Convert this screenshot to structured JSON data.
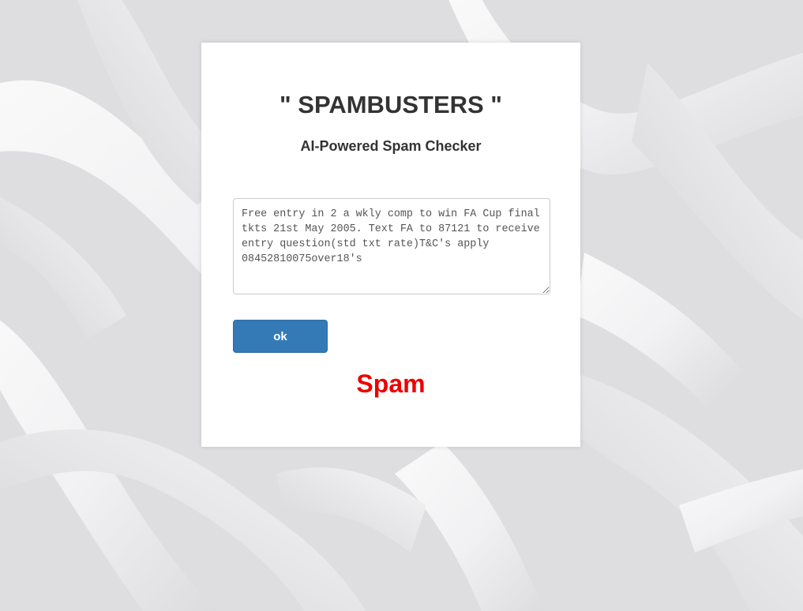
{
  "header": {
    "title": "\" SPAMBUSTERS \"",
    "subtitle": "AI-Powered Spam Checker"
  },
  "form": {
    "message_value": "Free entry in 2 a wkly comp to win FA Cup final tkts 21st May 2005. Text FA to 87121 to receive entry question(std txt rate)T&C's apply 08452810075over18's",
    "submit_label": "ok"
  },
  "result": {
    "label": "Spam",
    "color": "#ee0000"
  },
  "colors": {
    "button": "#337ab7",
    "text": "#333333"
  }
}
